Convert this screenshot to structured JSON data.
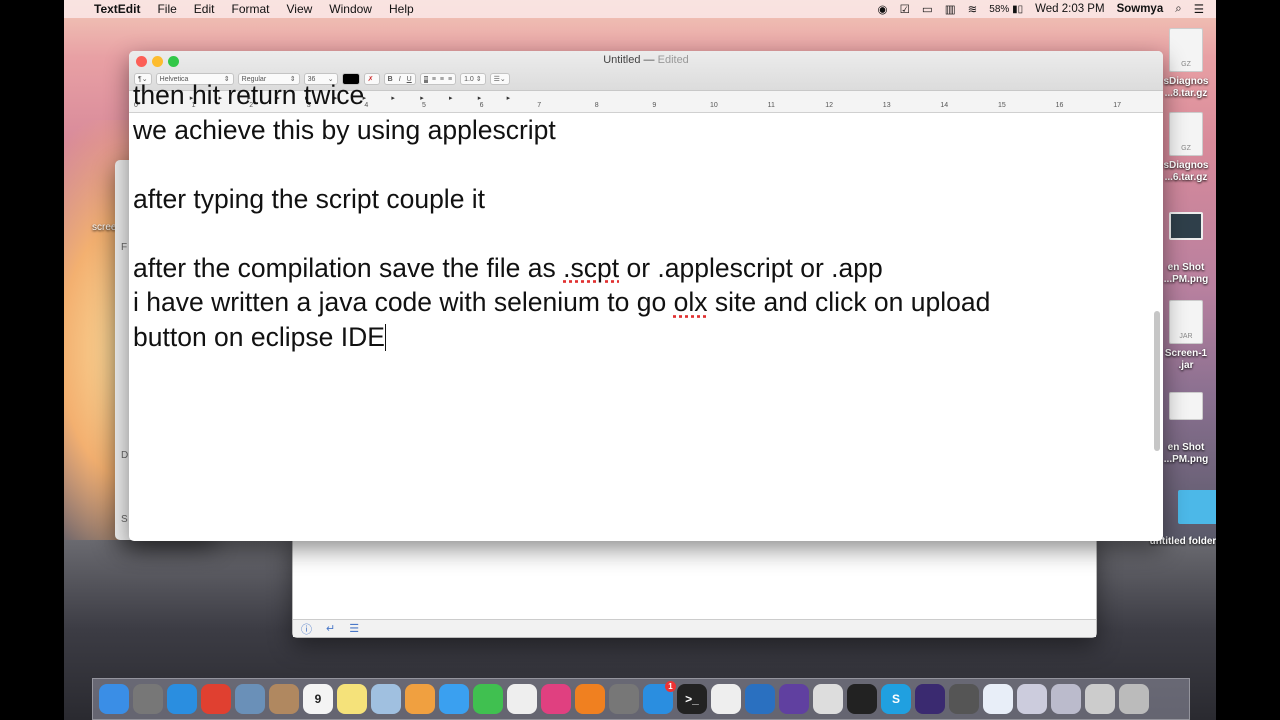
{
  "menubar": {
    "apple": "",
    "app": "TextEdit",
    "items": [
      "File",
      "Edit",
      "Format",
      "View",
      "Window",
      "Help"
    ],
    "battery": "58%",
    "clock": "Wed 2:03 PM",
    "user": "Sowmya"
  },
  "desktop": {
    "icons": [
      {
        "type": "GZ",
        "label1": "sDiagnos",
        "label2": "...8.tar.gz"
      },
      {
        "type": "GZ",
        "label1": "sDiagnos",
        "label2": "...6.tar.gz"
      },
      {
        "type": "",
        "label1": "en Shot",
        "label2": "...PM.png"
      },
      {
        "type": "JAR",
        "label1": "Screen-1",
        "label2": ".jar"
      },
      {
        "type": "",
        "label1": "en Shot",
        "label2": "...PM.png"
      },
      {
        "type": "",
        "label1": "untitled folder",
        "label2": ""
      }
    ],
    "left_label": "screen"
  },
  "textedit": {
    "title": "Untitled",
    "status": "Edited",
    "toolbar": {
      "paragraph": "¶",
      "font": "Helvetica",
      "style": "Regular",
      "size": "36",
      "bold": "B",
      "italic": "I",
      "underline": "U",
      "spacing": "1.0",
      "list": "☰"
    },
    "ruler": [
      "0",
      "1",
      "2",
      "3",
      "4",
      "5",
      "6",
      "7",
      "8",
      "9",
      "10",
      "11",
      "12",
      "13",
      "14",
      "15",
      "16",
      "17"
    ],
    "lines": [
      "then hit return twice",
      "we achieve this by using applescript",
      "",
      "after typing the script couple it",
      "",
      "after the compilation save the file as ",
      ".scpt",
      " or .applescript or .app",
      "i have written a java code with selenium to go ",
      "olx",
      " site and click on upload",
      "button on eclipse IDE"
    ]
  },
  "backwin": {
    "labels": [
      "F",
      "D",
      "S"
    ]
  },
  "dock": {
    "apps": [
      {
        "name": "finder",
        "color": "#3a8ee6"
      },
      {
        "name": "launchpad",
        "color": "#777"
      },
      {
        "name": "safari",
        "color": "#2a8ee0"
      },
      {
        "name": "chrome",
        "color": "#e04030"
      },
      {
        "name": "preview",
        "color": "#6a90b8"
      },
      {
        "name": "contacts",
        "color": "#b08860"
      },
      {
        "name": "calendar",
        "color": "#f4f4f4",
        "text": "9"
      },
      {
        "name": "notes",
        "color": "#f5e27a"
      },
      {
        "name": "photo-viewer",
        "color": "#a0c0e0"
      },
      {
        "name": "photos",
        "color": "#f0a040"
      },
      {
        "name": "messages",
        "color": "#3aa0f0"
      },
      {
        "name": "facetime",
        "color": "#40c050"
      },
      {
        "name": "reminders",
        "color": "#eee"
      },
      {
        "name": "itunes",
        "color": "#e04080"
      },
      {
        "name": "ibooks",
        "color": "#f08020"
      },
      {
        "name": "system-preferences",
        "color": "#777"
      },
      {
        "name": "app-store",
        "color": "#2a8ee0",
        "badge": "1"
      },
      {
        "name": "terminal",
        "color": "#222",
        "text": ">_"
      },
      {
        "name": "textedit",
        "color": "#eee"
      },
      {
        "name": "openoffice",
        "color": "#2a70c0"
      },
      {
        "name": "siri-like",
        "color": "#6040a0"
      },
      {
        "name": "script-editor",
        "color": "#ddd"
      },
      {
        "name": "activity-monitor",
        "color": "#222"
      },
      {
        "name": "skype",
        "color": "#20a0e0",
        "text": "S"
      },
      {
        "name": "eclipse",
        "color": "#3a2a70"
      },
      {
        "name": "quicktime",
        "color": "#555"
      },
      {
        "name": "documents",
        "color": "#e8eef8"
      },
      {
        "name": "downloads-stack",
        "color": "#ccd"
      },
      {
        "name": "screenshot-stack",
        "color": "#bbc"
      },
      {
        "name": "desktop-stack",
        "color": "#ccc"
      },
      {
        "name": "trash",
        "color": "#bbb"
      }
    ]
  },
  "colors": {
    "close": "#fc5f57",
    "minimize": "#fdbc2e",
    "zoom": "#33c748",
    "spell": "#e03030"
  }
}
